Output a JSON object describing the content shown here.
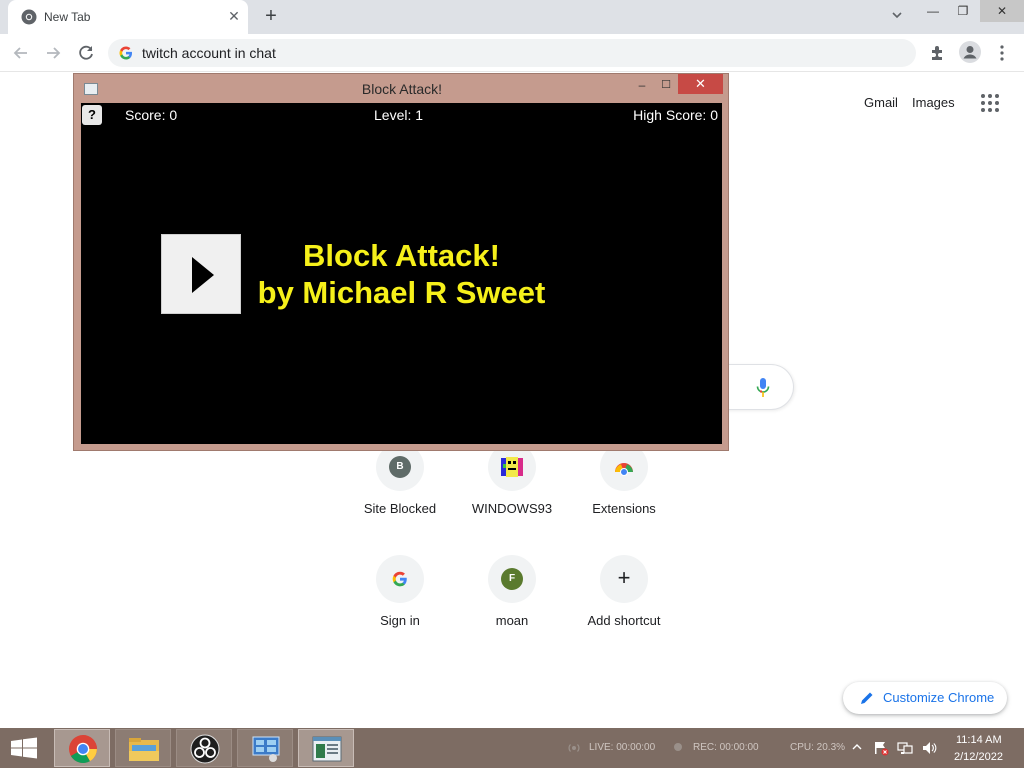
{
  "browser": {
    "tab_title": "New Tab",
    "tab_close": "✕",
    "new_tab": "+",
    "address": "twitch account in chat",
    "window_controls": {
      "minimize": "—",
      "restore": "❐",
      "close": "✕"
    }
  },
  "ntp": {
    "gmail": "Gmail",
    "images": "Images",
    "shortcuts": [
      {
        "label": "Site Blocked",
        "letter": "B",
        "color": "#5f6b68"
      },
      {
        "label": "WINDOWS93",
        "letter": "",
        "color": ""
      },
      {
        "label": "Extensions",
        "letter": "",
        "color": ""
      },
      {
        "label": "Sign in",
        "letter": "",
        "color": ""
      },
      {
        "label": "moan",
        "letter": "F",
        "color": "#5a7a2e"
      },
      {
        "label": "Add shortcut",
        "letter": "+",
        "color": ""
      }
    ],
    "customize": "Customize Chrome"
  },
  "game": {
    "window_title": "Block Attack!",
    "help": "?",
    "score": "Score: 0",
    "level": "Level: 1",
    "high_score": "High Score: 0",
    "title_line1": "Block Attack!",
    "title_line2": "by Michael R Sweet",
    "controls": {
      "minimize": "–",
      "maximize": "☐",
      "close": "✕"
    }
  },
  "taskbar": {
    "tray": {
      "live": "LIVE: 00:00:00",
      "rec": "REC: 00:00:00",
      "cpu": "CPU: 20.3%"
    },
    "clock_time": "11:14 AM",
    "clock_date": "2/12/2022"
  },
  "colors": {
    "game_title": "#f6f01a",
    "game_frame": "#c59b8e",
    "taskbar": "#7d6c63",
    "accent_blue": "#1a73e8"
  }
}
